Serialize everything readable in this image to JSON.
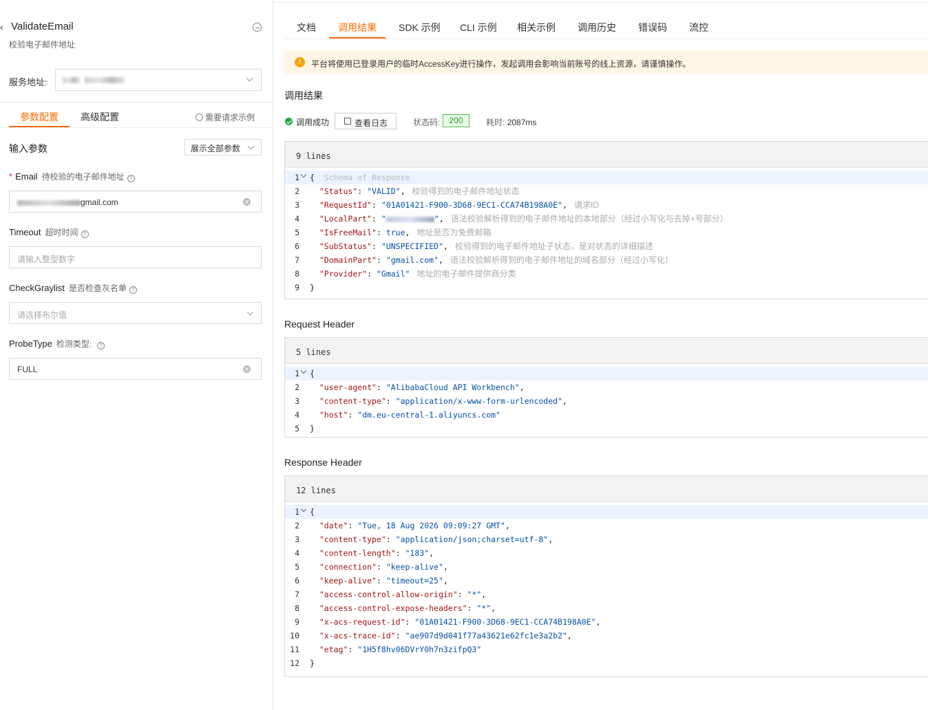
{
  "left": {
    "api_title": "ValidateEmail",
    "api_subtitle": "校验电子邮件地址",
    "service_label": "服务地址:",
    "tabs": [
      {
        "label": "参数配置",
        "active": true
      },
      {
        "label": "高级配置",
        "active": false
      }
    ],
    "need_example": "需要请求示例",
    "input_params": "输入参数",
    "show_all": "展示全部参数",
    "params": [
      {
        "name": "Email",
        "required": true,
        "desc": "待校验的电子邮件地址",
        "value_suffix": "gmail.com",
        "placeholder": ""
      },
      {
        "name": "Timeout",
        "required": false,
        "desc": "超时时间",
        "value": "",
        "placeholder": "请输入整型数字"
      },
      {
        "name": "CheckGraylist",
        "required": false,
        "desc": "是否检查灰名单",
        "value": "",
        "placeholder": "请选择布尔值"
      },
      {
        "name": "ProbeType",
        "required": false,
        "desc": "检测类型:",
        "value": "FULL",
        "placeholder": ""
      }
    ]
  },
  "right": {
    "tabs": [
      "文档",
      "调用结果",
      "SDK 示例",
      "CLI 示例",
      "相关示例",
      "调用历史",
      "错误码",
      "流控"
    ],
    "active_tab": "调用结果",
    "alert": "平台将使用已登录用户的临时AccessKey进行操作，发起调用会影响当前账号的线上资源，请谨慎操作。",
    "result_title": "调用结果",
    "success_text": "调用成功",
    "log_button": "查看日志",
    "status_label": "状态码:",
    "status_code": "200",
    "time_label": "耗时:",
    "time_value": "2087ms",
    "response": {
      "lines_label": "9 lines",
      "schema_hint": "Schema of Response",
      "rows": [
        {
          "key": "Status",
          "value": "\"VALID\"",
          "comment": "校验得到的电子邮件地址状态"
        },
        {
          "key": "RequestId",
          "value": "\"01A01421-F900-3D68-9EC1-CCA74B198A0E\"",
          "comment": "请求ID"
        },
        {
          "key": "LocalPart",
          "value": "redacted",
          "comment": "语法校验解析得到的电子邮件地址的本地部分（经过小写化与去掉+号部分）"
        },
        {
          "key": "IsFreeMail",
          "value": "true",
          "comment": "地址是否为免费邮箱"
        },
        {
          "key": "SubStatus",
          "value": "\"UNSPECIFIED\"",
          "comment": "校验得到的电子邮件地址子状态，是对状态的详细描述"
        },
        {
          "key": "DomainPart",
          "value": "\"gmail.com\"",
          "comment": "语法校验解析得到的电子邮件地址的域名部分（经过小写化）"
        },
        {
          "key": "Provider",
          "value": "\"Gmail\"",
          "comment": "地址的电子邮件提供商分类"
        }
      ]
    },
    "request_header_title": "Request Header",
    "request_header": {
      "lines_label": "5 lines",
      "rows": [
        {
          "key": "user-agent",
          "value": "\"AlibabaCloud API Workbench\""
        },
        {
          "key": "content-type",
          "value": "\"application/x-www-form-urlencoded\""
        },
        {
          "key": "host",
          "value": "\"dm.eu-central-1.aliyuncs.com\""
        }
      ]
    },
    "response_header_title": "Response Header",
    "response_header": {
      "lines_label": "12 lines",
      "rows": [
        {
          "key": "date",
          "value": "\"Tue, 18 Aug 2026 09:09:27 GMT\""
        },
        {
          "key": "content-type",
          "value": "\"application/json;charset=utf-8\""
        },
        {
          "key": "content-length",
          "value": "\"183\""
        },
        {
          "key": "connection",
          "value": "\"keep-alive\""
        },
        {
          "key": "keep-alive",
          "value": "\"timeout=25\""
        },
        {
          "key": "access-control-allow-origin",
          "value": "\"*\""
        },
        {
          "key": "access-control-expose-headers",
          "value": "\"*\""
        },
        {
          "key": "x-acs-request-id",
          "value": "\"01A01421-F900-3D68-9EC1-CCA74B198A0E\""
        },
        {
          "key": "x-acs-trace-id",
          "value": "\"ae907d9d041f77a43621e62fc1e3a2b2\""
        },
        {
          "key": "etag",
          "value": "\"1H5f8hv06DVrY0h7n3zifpQ3\""
        }
      ]
    }
  },
  "colors": {
    "accent": "#ff6a00",
    "success": "#20a845",
    "warning_bg": "#fff5e6"
  }
}
